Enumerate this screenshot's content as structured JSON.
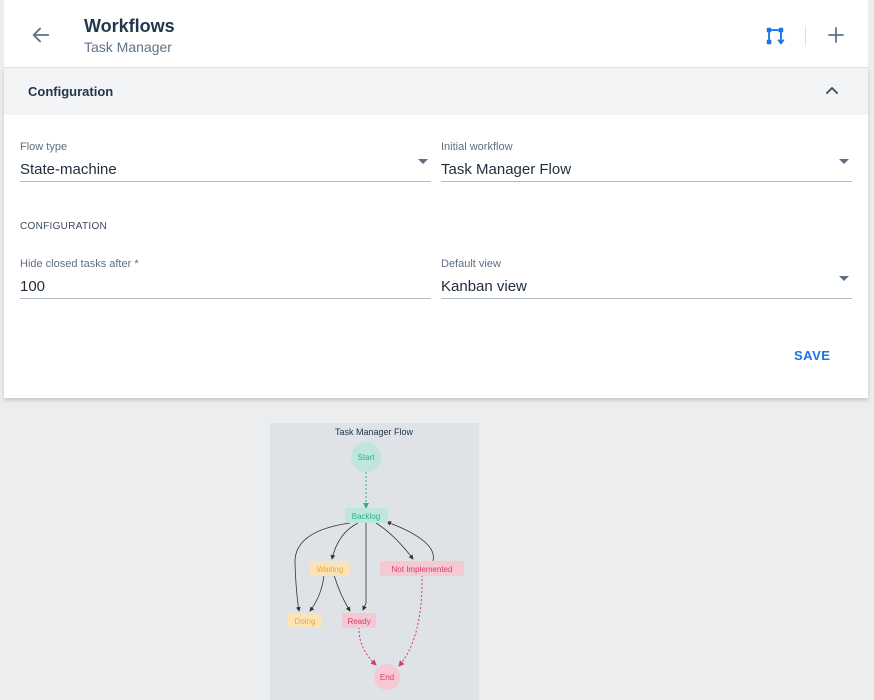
{
  "header": {
    "title": "Workflows",
    "subtitle": "Task Manager",
    "icons": {
      "back": "arrow-left-icon",
      "flow": "workflow-icon",
      "add": "plus-icon"
    }
  },
  "configuration_panel": {
    "title": "Configuration",
    "flow_type": {
      "label": "Flow type",
      "value": "State-machine"
    },
    "initial_workflow": {
      "label": "Initial workflow",
      "value": "Task Manager Flow"
    },
    "section_label": "CONFIGURATION",
    "hide_closed": {
      "label": "Hide closed tasks after *",
      "value": "100"
    },
    "default_view": {
      "label": "Default view",
      "value": "Kanban view"
    },
    "save_label": "SAVE"
  },
  "diagram": {
    "title": "Task Manager Flow",
    "nodes": {
      "start": "Start",
      "backlog": "Backlog",
      "waiting": "Waiting",
      "not_implemented": "Not Implemented",
      "doing": "Doing",
      "ready": "Ready",
      "end": "End"
    }
  },
  "colors": {
    "accent": "#1a73e8",
    "start_fill": "#bfe6dc",
    "start_text": "#2bb090",
    "waiting_fill": "#fbe3b8",
    "waiting_text": "#f0a830",
    "danger_fill": "#f4c9d4",
    "danger_text": "#d63c6b"
  }
}
